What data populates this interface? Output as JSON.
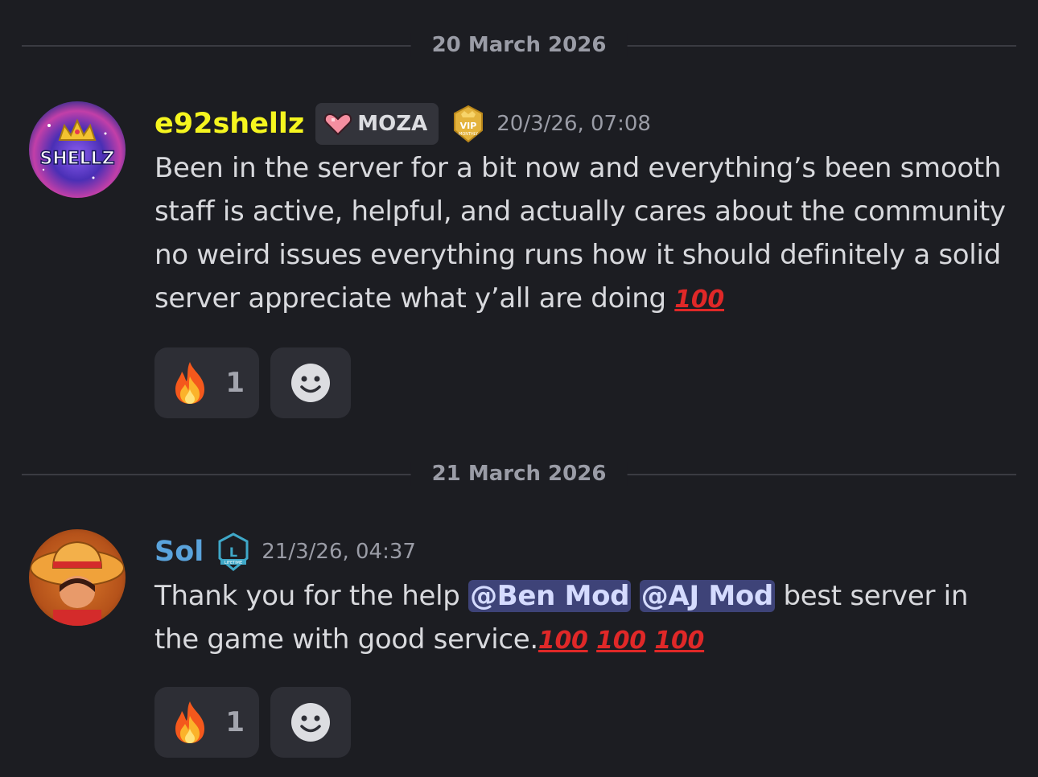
{
  "dates": [
    "20 March 2026",
    "21 March 2026"
  ],
  "messages": [
    {
      "username": "e92shellz",
      "username_color": "#f5f51f",
      "avatar_text": "SHELLZ",
      "tag": "MOZA",
      "badge": "VIP MONTHLY",
      "timestamp": "20/3/26, 07:08",
      "text": "Been in the server for a bit now and everything’s been smooth staff is active, helpful, and actually cares about the community no weird issues everything runs how it should definitely a solid server appreciate what y’all are doing",
      "trailing_emoji": "100",
      "reactions": [
        {
          "emoji": "fire-icon",
          "count": "1"
        }
      ]
    },
    {
      "username": "Sol",
      "username_color": "#5aa3dc",
      "badge": "LIFETIME",
      "timestamp": "21/3/26, 04:37",
      "text_before": "Thank you for the help",
      "mentions": [
        "@Ben Mod",
        "@AJ Mod"
      ],
      "text_after": "best server in the game with good service.",
      "trailing_emoji": "100",
      "reactions": [
        {
          "emoji": "fire-icon",
          "count": "1"
        }
      ]
    }
  ],
  "colors": {
    "background": "#1c1d22",
    "mention_bg": "#3e4378",
    "reaction_bg": "#2d2e35"
  }
}
